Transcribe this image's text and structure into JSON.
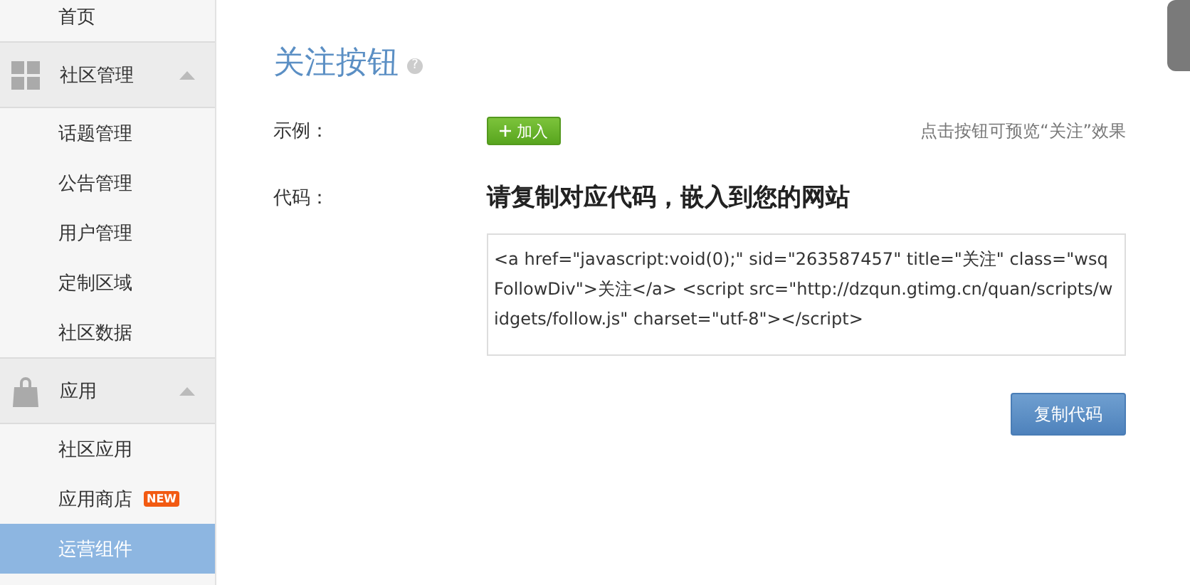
{
  "sidebar": [
    {
      "kind": "item",
      "label": "首页",
      "selected": false
    },
    {
      "kind": "group",
      "label": "社区管理",
      "expanded": true,
      "children": [
        {
          "label": "话题管理",
          "selected": false
        },
        {
          "label": "公告管理",
          "selected": false
        },
        {
          "label": "用户管理",
          "selected": false
        },
        {
          "label": "定制区域",
          "selected": false
        },
        {
          "label": "社区数据",
          "selected": false
        }
      ]
    },
    {
      "kind": "group",
      "label": "应用",
      "expanded": true,
      "children": [
        {
          "label": "社区应用",
          "selected": false
        },
        {
          "label": "应用商店",
          "selected": false,
          "badge": "NEW"
        },
        {
          "label": "运营组件",
          "selected": true
        }
      ]
    }
  ],
  "main": {
    "title": "关注按钮",
    "help": "?",
    "example": {
      "label": "示例：",
      "button": "加入",
      "hint": "点击按钮可预览“关注”效果"
    },
    "code": {
      "label": "代码：",
      "heading": "请复制对应代码，嵌入到您的网站",
      "value": " <a href=\"javascript:void(0);\" sid=\"263587457\" title=\"关注\" class=\"wsqFollowDiv\">关注</a> <script src=\"http://dzqun.gtimg.cn/quan/scripts/widgets/follow.js\" charset=\"utf-8\"></script>"
    },
    "copy_button": "复制代码"
  }
}
